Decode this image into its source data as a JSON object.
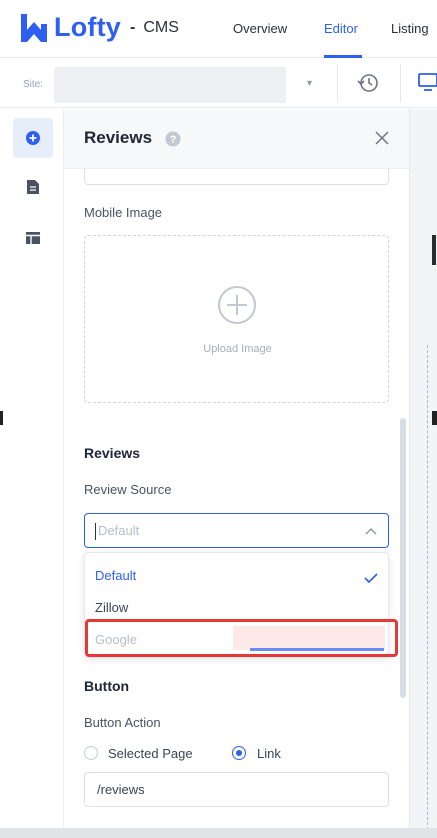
{
  "header": {
    "brand": "Lofty",
    "product_sep": "-",
    "product": "CMS",
    "nav": [
      {
        "label": "Overview",
        "active": false
      },
      {
        "label": "Editor",
        "active": true
      },
      {
        "label": "Listing",
        "active": false
      }
    ]
  },
  "sitebar": {
    "site_label": "Site:",
    "icons": [
      "history-icon",
      "desktop-icon"
    ]
  },
  "rail": {
    "items": [
      {
        "icon": "add-circle-icon",
        "active": true
      },
      {
        "icon": "page-icon",
        "active": false
      },
      {
        "icon": "layout-icon",
        "active": false
      }
    ]
  },
  "panel": {
    "title": "Reviews",
    "mobile_image_label": "Mobile Image",
    "upload_text": "Upload Image",
    "reviews_section": "Reviews",
    "review_source_label": "Review Source",
    "review_source_placeholder": "Default",
    "dropdown_options": [
      {
        "label": "Default",
        "state": "selected"
      },
      {
        "label": "Zillow",
        "state": "normal"
      },
      {
        "label": "Google",
        "state": "disabled"
      }
    ],
    "button_section": "Button",
    "button_action_label": "Button Action",
    "button_action_options": [
      {
        "label": "Selected Page",
        "checked": false
      },
      {
        "label": "Link",
        "checked": true
      }
    ],
    "link_value": "/reviews"
  },
  "colors": {
    "brand": "#2d5ff2",
    "highlight": "#e53935"
  }
}
